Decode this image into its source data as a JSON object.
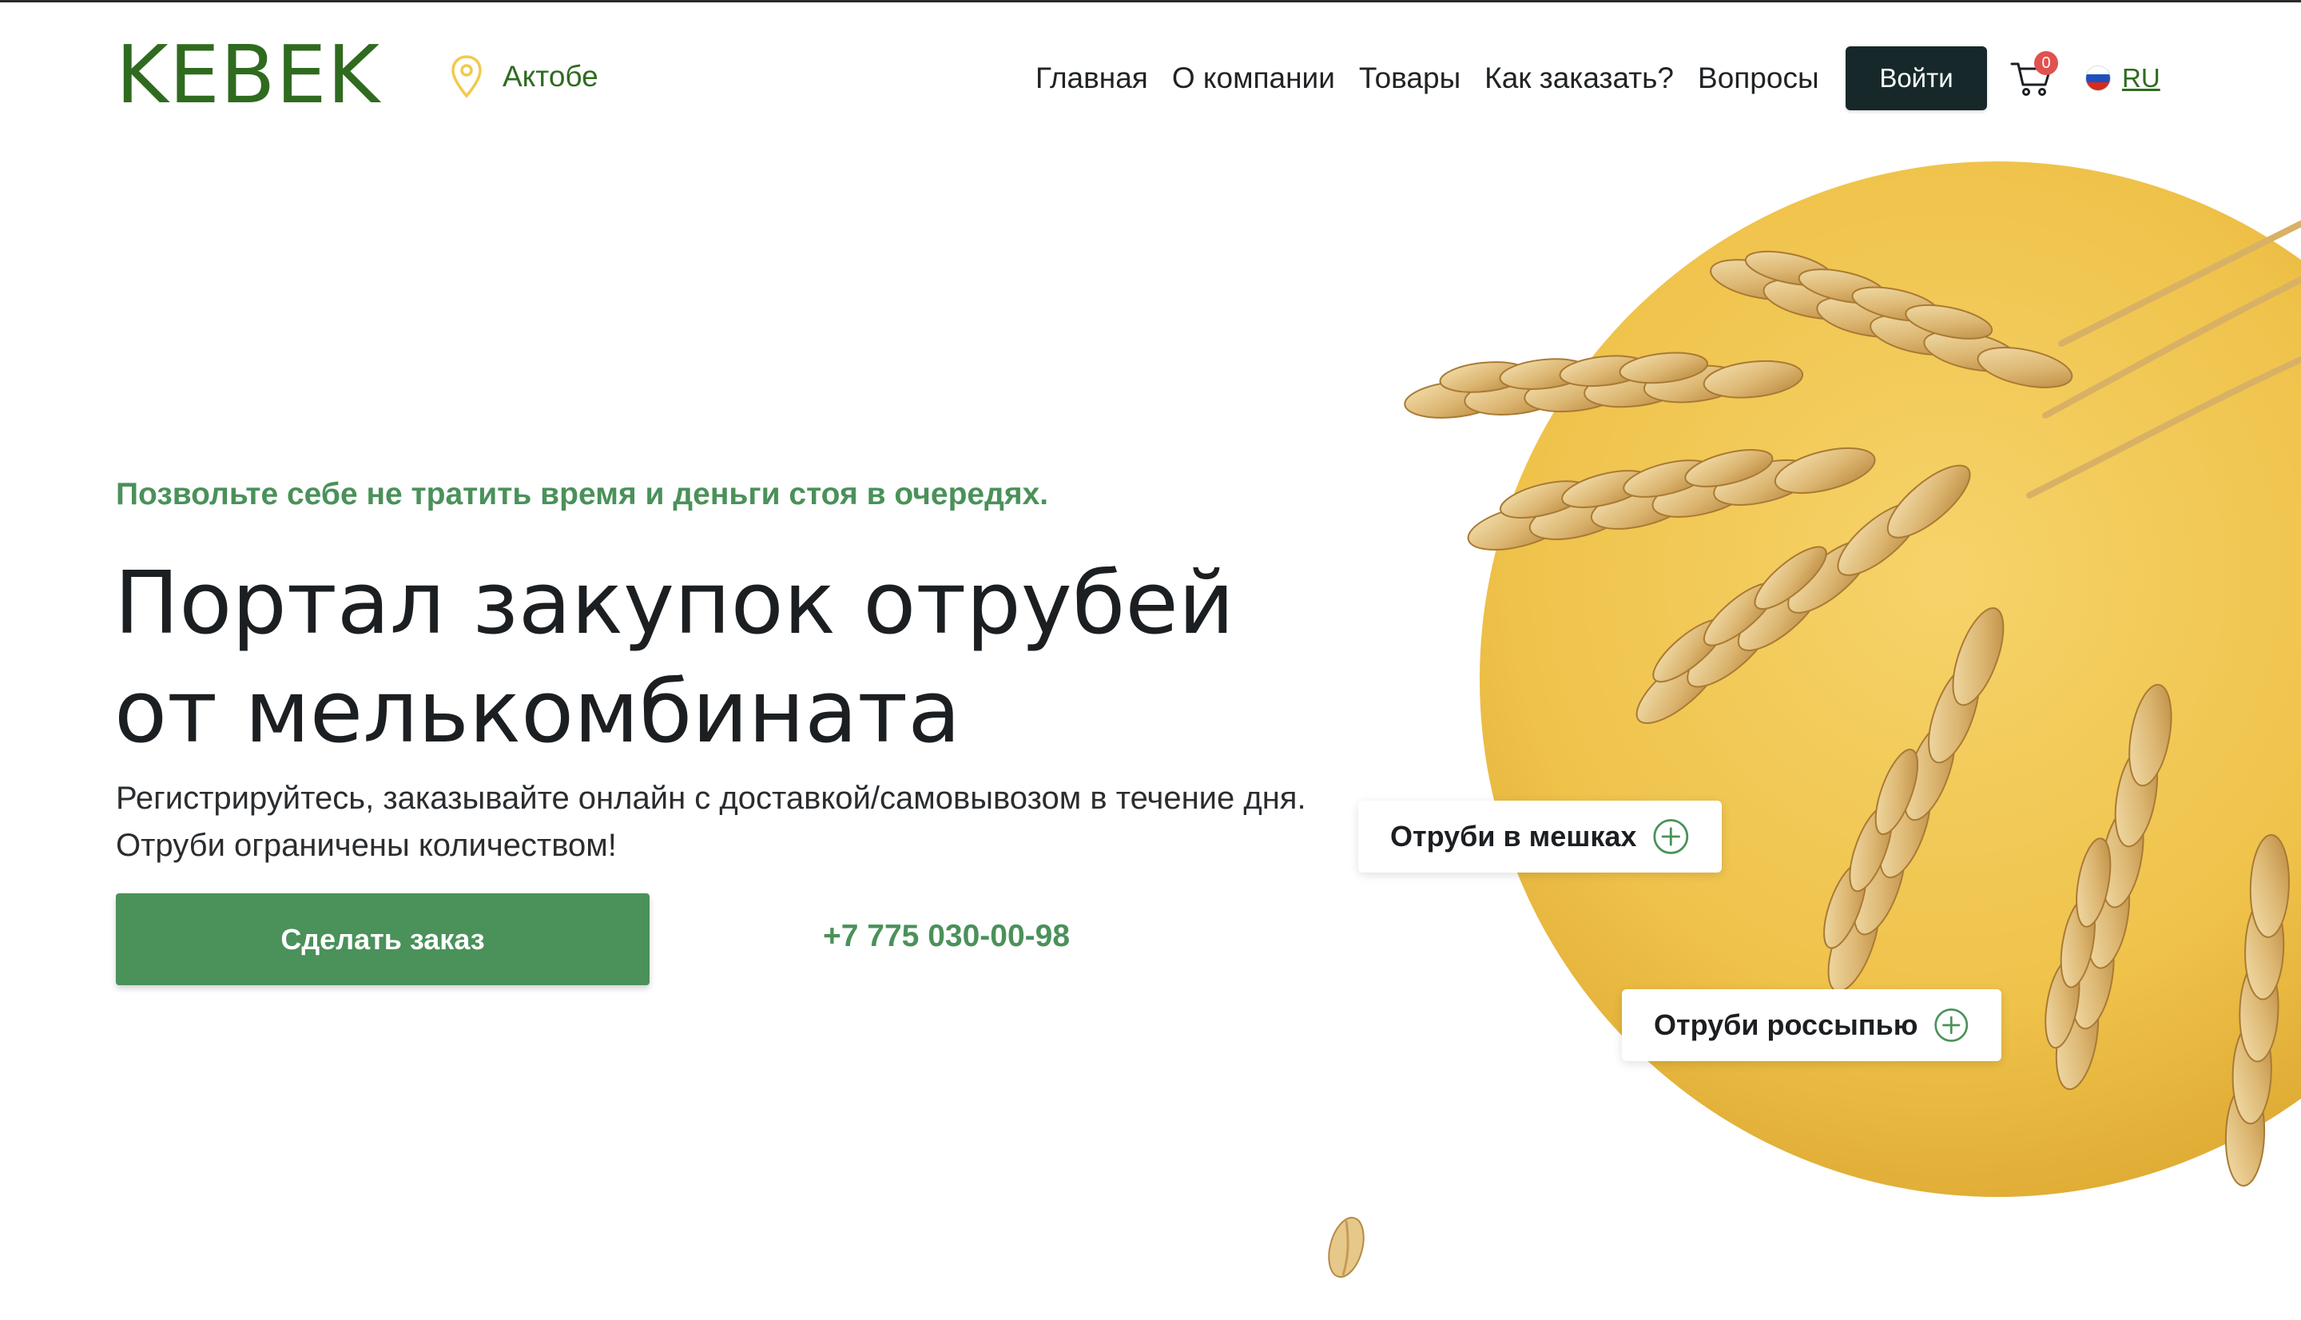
{
  "header": {
    "logo": "KEBEK",
    "city": "Актобе",
    "nav": [
      "Главная",
      "О компании",
      "Товары",
      "Как заказать?",
      "Вопросы"
    ],
    "login_label": "Войти",
    "cart_count": "0",
    "language": "RU"
  },
  "hero": {
    "tagline": "Позвольте себе не тратить время и деньги стоя в очередях.",
    "headline": "Портал закупок отрубей от мелькомбината",
    "subtext": "Регистрируйтесь, заказывайте онлайн с доставкой/самовывозом в течение дня. Отруби ограничены количеством!",
    "order_button": "Сделать заказ",
    "phone": "+7 775 030-00-98"
  },
  "products": [
    {
      "label": "Отруби в мешках"
    },
    {
      "label": "Отруби россыпью"
    }
  ],
  "colors": {
    "brand_green": "#4a915a",
    "logo_green": "#2f6b1f",
    "dark_button": "#16282a",
    "yellow": "#f2c94c",
    "badge_red": "#e0524f"
  },
  "icons": [
    "location-pin-icon",
    "cart-icon",
    "russian-flag-icon",
    "plus-circle-icon"
  ]
}
